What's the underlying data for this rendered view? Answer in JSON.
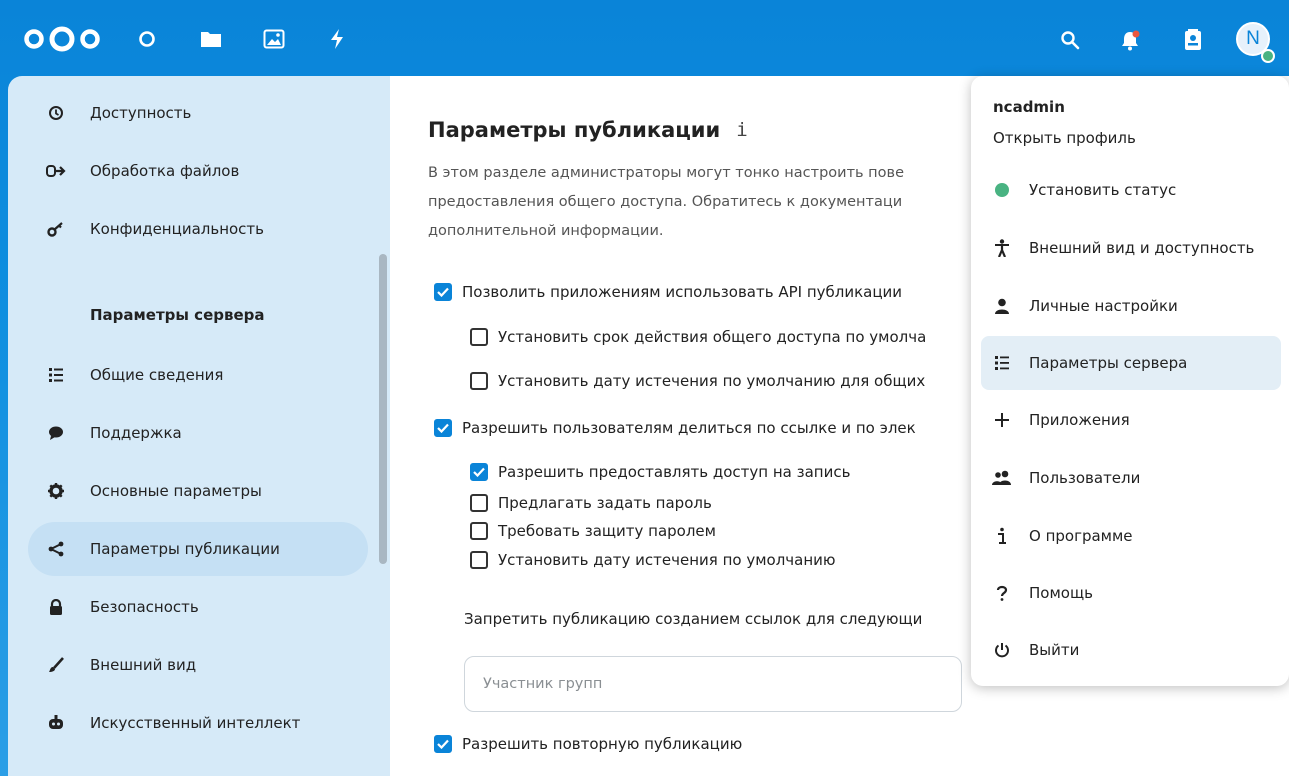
{
  "colors": {
    "brand": "#0a84d8",
    "status_online": "#49b382",
    "sidebar_bg": "#d6eaf8",
    "checkbox_checked": "#0a84d8"
  },
  "header": {
    "app_icons": [
      "dashboard-icon",
      "files-icon",
      "photos-icon",
      "activity-icon"
    ],
    "right_icons": [
      "search-icon",
      "notifications-icon",
      "contacts-icon"
    ],
    "avatar_letter": "N"
  },
  "sidebar": {
    "items_top": [
      {
        "icon": "clock-icon",
        "label": "Доступность"
      },
      {
        "icon": "file-processing-icon",
        "label": "Обработка файлов"
      },
      {
        "icon": "key-icon",
        "label": "Конфиденциальность"
      }
    ],
    "section_title": "Параметры сервера",
    "items": [
      {
        "icon": "list-icon",
        "label": "Общие сведения"
      },
      {
        "icon": "chat-icon",
        "label": "Поддержка"
      },
      {
        "icon": "gear-icon",
        "label": "Основные параметры"
      },
      {
        "icon": "share-icon",
        "label": "Параметры публикации",
        "active": true
      },
      {
        "icon": "lock-icon",
        "label": "Безопасность"
      },
      {
        "icon": "brush-icon",
        "label": "Внешний вид"
      },
      {
        "icon": "robot-icon",
        "label": "Искусственный интеллект"
      }
    ]
  },
  "main": {
    "title": "Параметры публикации",
    "info_icon": "i",
    "description_lines": [
      "В этом разделе администраторы могут тонко настроить пове",
      "предоставления общего доступа. Обратитесь к документаци",
      "дополнительной информации."
    ],
    "options": {
      "allow_api": {
        "label": "Позволить приложениям использовать API публикации",
        "checked": true
      },
      "default_expiry_share": {
        "label": "Установить срок действия общего доступа по умолча",
        "checked": false
      },
      "default_expiry_remote": {
        "label": "Установить дату истечения по умолчанию для общих",
        "checked": false
      },
      "allow_links": {
        "label": "Разрешить пользователям делиться по ссылке и по элек",
        "checked": true
      },
      "allow_upload": {
        "label": "Разрешить предоставлять доступ на запись",
        "checked": true
      },
      "suggest_password": {
        "label": "Предлагать задать пароль",
        "checked": false
      },
      "enforce_password": {
        "label": "Требовать защиту паролем",
        "checked": false
      },
      "default_expiry_links": {
        "label": "Установить дату истечения по умолчанию",
        "checked": false
      },
      "allow_resharing": {
        "label": "Разрешить повторную публикацию",
        "checked": true
      }
    },
    "deny_label": "Запретить публикацию созданием ссылок для следующи",
    "group_placeholder": "Участник групп"
  },
  "menu": {
    "username": "ncadmin",
    "profile_link": "Открыть профиль",
    "items": [
      {
        "icon": "status-dot-icon",
        "label": "Установить статус"
      },
      {
        "icon": "accessibility-icon",
        "label": "Внешний вид и доступность"
      },
      {
        "icon": "user-icon",
        "label": "Личные настройки"
      },
      {
        "icon": "list-icon",
        "label": "Параметры сервера",
        "active": true
      },
      {
        "icon": "plus-icon",
        "label": "Приложения"
      },
      {
        "icon": "users-icon",
        "label": "Пользователи"
      },
      {
        "icon": "info-icon",
        "label": "О программе"
      },
      {
        "icon": "help-icon",
        "label": "Помощь"
      },
      {
        "icon": "power-icon",
        "label": "Выйти"
      }
    ]
  }
}
